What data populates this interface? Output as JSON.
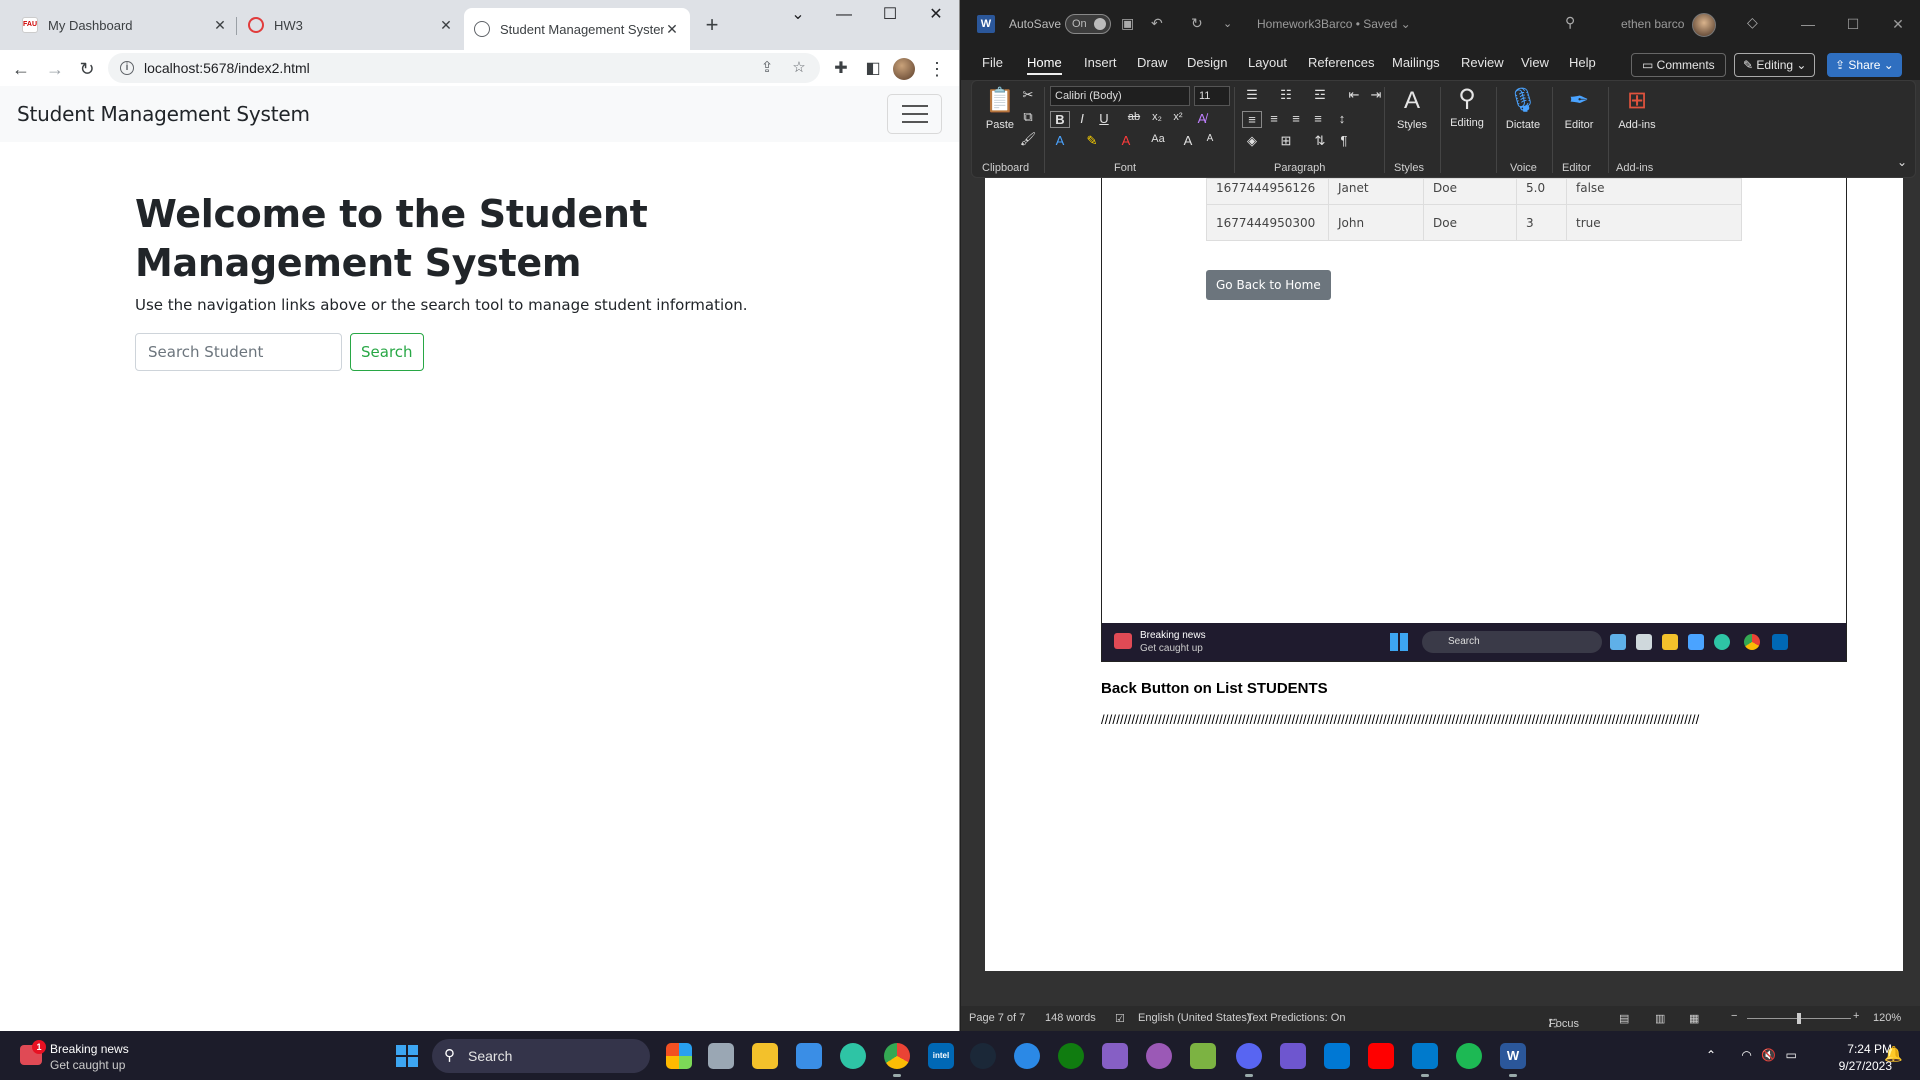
{
  "chrome": {
    "tabs": [
      {
        "title": "My Dashboard",
        "icon": "fau-icon"
      },
      {
        "title": "HW3",
        "icon": "canvas-icon"
      },
      {
        "title": "Student Management System",
        "icon": "globe-icon"
      }
    ],
    "url": "localhost:5678/index2.html"
  },
  "site": {
    "brand": "Student Management System",
    "heading": "Welcome to the Student Management System",
    "lead": "Use the navigation links above or the search tool to manage student information.",
    "search_placeholder": "Search Student",
    "search_button": "Search"
  },
  "word": {
    "autosave_label": "AutoSave",
    "autosave_state": "On",
    "doc_title": "Homework3Barco • Saved ⌄",
    "user": "ethen barco",
    "menus": [
      "File",
      "Home",
      "Insert",
      "Draw",
      "Design",
      "Layout",
      "References",
      "Mailings",
      "Review",
      "View",
      "Help"
    ],
    "comments": "Comments",
    "editing": "Editing",
    "share": "Share",
    "ribbon": {
      "paste": "Paste",
      "clipboard": "Clipboard",
      "font_name": "Calibri (Body)",
      "font_size": "11",
      "font": "Font",
      "paragraph": "Paragraph",
      "styles": "Styles",
      "styles_group": "Styles",
      "editing_btn": "Editing",
      "dictate": "Dictate",
      "voice": "Voice",
      "editor": "Editor",
      "editor_group": "Editor",
      "addins": "Add-ins",
      "addins_group": "Add-ins"
    },
    "table_rows": [
      [
        "1677444956126",
        "Janet",
        "Doe",
        "5.0",
        "false"
      ],
      [
        "1677444950300",
        "John",
        "Doe",
        "3",
        "true"
      ]
    ],
    "go_back": "Go Back to Home",
    "mini_taskbar": {
      "news1": "Breaking news",
      "news2": "Get caught up",
      "search": "Search"
    },
    "caption": "Back Button on List STUDENTS",
    "slashes": "/////////////////////////////////////////////////////////////////////////////////////////////////////////////////////////////////////////////////////////////",
    "status": {
      "page": "Page 7 of 7",
      "words": "148 words",
      "language": "English (United States)",
      "predictions": "Text Predictions: On",
      "focus": "Focus",
      "zoom": "120%"
    }
  },
  "taskbar": {
    "news1": "Breaking news",
    "news2": "Get caught up",
    "news_badge": "1",
    "search": "Search",
    "time": "7:24 PM",
    "date": "9/27/2023"
  }
}
